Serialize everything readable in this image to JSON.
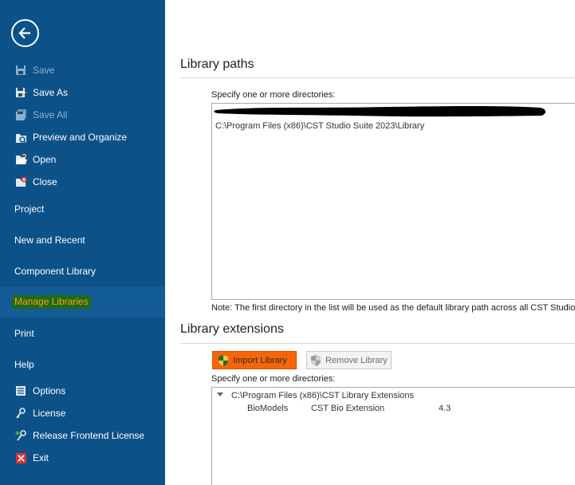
{
  "sidebar": {
    "commands": [
      {
        "label": "Save",
        "icon": "save-icon",
        "enabled": false
      },
      {
        "label": "Save As",
        "icon": "save-as-icon",
        "enabled": true
      },
      {
        "label": "Save All",
        "icon": "save-all-icon",
        "enabled": false
      },
      {
        "label": "Preview and Organize",
        "icon": "preview-organize-icon",
        "enabled": true
      },
      {
        "label": "Open",
        "icon": "open-folder-icon",
        "enabled": true
      },
      {
        "label": "Close",
        "icon": "close-folder-icon",
        "enabled": true
      }
    ],
    "sections": [
      "Project",
      "New and Recent",
      "Component Library",
      "Manage Libraries",
      "Print",
      "Help"
    ],
    "help_items": [
      {
        "label": "Options",
        "icon": "options-icon"
      },
      {
        "label": "License",
        "icon": "license-icon"
      },
      {
        "label": "Release Frontend License",
        "icon": "release-license-icon"
      },
      {
        "label": "Exit",
        "icon": "exit-icon"
      }
    ]
  },
  "library_paths": {
    "title": "Library paths",
    "specify_label": "Specify one or more directories:",
    "entries": [
      "C:\\Program Files (x86)\\CST Studio Suite 2023\\Library"
    ],
    "note": "Note: The first directory in the list will be used as the default library path across all CST Studio S"
  },
  "library_extensions": {
    "title": "Library extensions",
    "import_label": "Import Library",
    "remove_label": "Remove Library",
    "specify_label": "Specify one or more directories:",
    "root": "C:\\Program Files (x86)\\CST Library Extensions",
    "children": [
      {
        "name": "BioModels",
        "description": "CST Bio Extension",
        "version": "4.3"
      }
    ]
  },
  "colors": {
    "sidebar_bg": "#0d5189",
    "highlight_bg": "#1f6b18",
    "highlight_text": "#ff9a1f",
    "import_button_bg": "#f76508"
  }
}
